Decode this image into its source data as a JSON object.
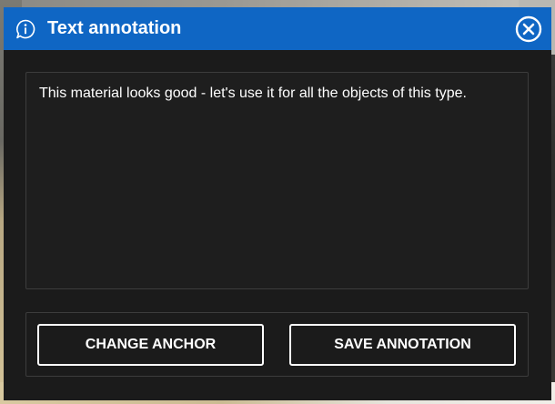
{
  "dialog": {
    "title": "Text annotation",
    "title_icon": "info-bubble-icon",
    "close_icon": "close-circle-icon",
    "accent_color": "#0f66c4",
    "background_color": "#1b1b1b"
  },
  "annotation": {
    "text": "This material looks good - let's use it for all the objects of this type."
  },
  "buttons": {
    "change_anchor_label": "CHANGE ANCHOR",
    "save_label": "SAVE ANNOTATION"
  }
}
